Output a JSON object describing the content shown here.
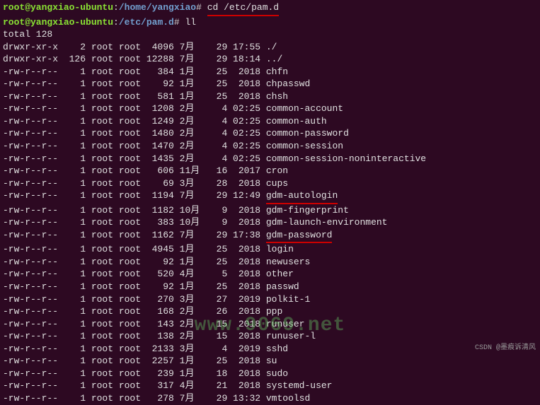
{
  "prompt1": {
    "userhost": "root@yangxiao-ubuntu",
    "path": "/home/yangxiao",
    "symbol": "#",
    "command": "cd /etc/pam.d"
  },
  "prompt2": {
    "userhost": "root@yangxiao-ubuntu",
    "path": "/etc/pam.d",
    "symbol": "#",
    "command": "ll"
  },
  "total_line": "total 128",
  "listing": [
    {
      "perm": "drwxr-xr-x",
      "links": "2",
      "owner": "root",
      "group": "root",
      "size": "4096",
      "month": "7月",
      "day": "29",
      "time": "17:55",
      "name": "./"
    },
    {
      "perm": "drwxr-xr-x",
      "links": "126",
      "owner": "root",
      "group": "root",
      "size": "12288",
      "month": "7月",
      "day": "29",
      "time": "18:14",
      "name": "../"
    },
    {
      "perm": "-rw-r--r--",
      "links": "1",
      "owner": "root",
      "group": "root",
      "size": "384",
      "month": "1月",
      "day": "25",
      "time": "2018",
      "name": "chfn"
    },
    {
      "perm": "-rw-r--r--",
      "links": "1",
      "owner": "root",
      "group": "root",
      "size": "92",
      "month": "1月",
      "day": "25",
      "time": "2018",
      "name": "chpasswd"
    },
    {
      "perm": "-rw-r--r--",
      "links": "1",
      "owner": "root",
      "group": "root",
      "size": "581",
      "month": "1月",
      "day": "25",
      "time": "2018",
      "name": "chsh"
    },
    {
      "perm": "-rw-r--r--",
      "links": "1",
      "owner": "root",
      "group": "root",
      "size": "1208",
      "month": "2月",
      "day": "4",
      "time": "02:25",
      "name": "common-account"
    },
    {
      "perm": "-rw-r--r--",
      "links": "1",
      "owner": "root",
      "group": "root",
      "size": "1249",
      "month": "2月",
      "day": "4",
      "time": "02:25",
      "name": "common-auth"
    },
    {
      "perm": "-rw-r--r--",
      "links": "1",
      "owner": "root",
      "group": "root",
      "size": "1480",
      "month": "2月",
      "day": "4",
      "time": "02:25",
      "name": "common-password"
    },
    {
      "perm": "-rw-r--r--",
      "links": "1",
      "owner": "root",
      "group": "root",
      "size": "1470",
      "month": "2月",
      "day": "4",
      "time": "02:25",
      "name": "common-session"
    },
    {
      "perm": "-rw-r--r--",
      "links": "1",
      "owner": "root",
      "group": "root",
      "size": "1435",
      "month": "2月",
      "day": "4",
      "time": "02:25",
      "name": "common-session-noninteractive"
    },
    {
      "perm": "-rw-r--r--",
      "links": "1",
      "owner": "root",
      "group": "root",
      "size": "606",
      "month": "11月",
      "day": "16",
      "time": "2017",
      "name": "cron"
    },
    {
      "perm": "-rw-r--r--",
      "links": "1",
      "owner": "root",
      "group": "root",
      "size": "69",
      "month": "3月",
      "day": "28",
      "time": "2018",
      "name": "cups"
    },
    {
      "perm": "-rw-r--r--",
      "links": "1",
      "owner": "root",
      "group": "root",
      "size": "1194",
      "month": "7月",
      "day": "29",
      "time": "12:49",
      "name": "gdm-autologin",
      "underline": true
    },
    {
      "perm": "-rw-r--r--",
      "links": "1",
      "owner": "root",
      "group": "root",
      "size": "1182",
      "month": "10月",
      "day": "9",
      "time": "2018",
      "name": "gdm-fingerprint"
    },
    {
      "perm": "-rw-r--r--",
      "links": "1",
      "owner": "root",
      "group": "root",
      "size": "383",
      "month": "10月",
      "day": "9",
      "time": "2018",
      "name": "gdm-launch-environment"
    },
    {
      "perm": "-rw-r--r--",
      "links": "1",
      "owner": "root",
      "group": "root",
      "size": "1162",
      "month": "7月",
      "day": "29",
      "time": "17:38",
      "name": "gdm-password",
      "underline": true
    },
    {
      "perm": "-rw-r--r--",
      "links": "1",
      "owner": "root",
      "group": "root",
      "size": "4945",
      "month": "1月",
      "day": "25",
      "time": "2018",
      "name": "login"
    },
    {
      "perm": "-rw-r--r--",
      "links": "1",
      "owner": "root",
      "group": "root",
      "size": "92",
      "month": "1月",
      "day": "25",
      "time": "2018",
      "name": "newusers"
    },
    {
      "perm": "-rw-r--r--",
      "links": "1",
      "owner": "root",
      "group": "root",
      "size": "520",
      "month": "4月",
      "day": "5",
      "time": "2018",
      "name": "other"
    },
    {
      "perm": "-rw-r--r--",
      "links": "1",
      "owner": "root",
      "group": "root",
      "size": "92",
      "month": "1月",
      "day": "25",
      "time": "2018",
      "name": "passwd"
    },
    {
      "perm": "-rw-r--r--",
      "links": "1",
      "owner": "root",
      "group": "root",
      "size": "270",
      "month": "3月",
      "day": "27",
      "time": "2019",
      "name": "polkit-1"
    },
    {
      "perm": "-rw-r--r--",
      "links": "1",
      "owner": "root",
      "group": "root",
      "size": "168",
      "month": "2月",
      "day": "26",
      "time": "2018",
      "name": "ppp"
    },
    {
      "perm": "-rw-r--r--",
      "links": "1",
      "owner": "root",
      "group": "root",
      "size": "143",
      "month": "2月",
      "day": "15",
      "time": "2018",
      "name": "runuser"
    },
    {
      "perm": "-rw-r--r--",
      "links": "1",
      "owner": "root",
      "group": "root",
      "size": "138",
      "month": "2月",
      "day": "15",
      "time": "2018",
      "name": "runuser-l"
    },
    {
      "perm": "-rw-r--r--",
      "links": "1",
      "owner": "root",
      "group": "root",
      "size": "2133",
      "month": "3月",
      "day": "4",
      "time": "2019",
      "name": "sshd"
    },
    {
      "perm": "-rw-r--r--",
      "links": "1",
      "owner": "root",
      "group": "root",
      "size": "2257",
      "month": "1月",
      "day": "25",
      "time": "2018",
      "name": "su"
    },
    {
      "perm": "-rw-r--r--",
      "links": "1",
      "owner": "root",
      "group": "root",
      "size": "239",
      "month": "1月",
      "day": "18",
      "time": "2018",
      "name": "sudo"
    },
    {
      "perm": "-rw-r--r--",
      "links": "1",
      "owner": "root",
      "group": "root",
      "size": "317",
      "month": "4月",
      "day": "21",
      "time": "2018",
      "name": "systemd-user"
    },
    {
      "perm": "-rw-r--r--",
      "links": "1",
      "owner": "root",
      "group": "root",
      "size": "278",
      "month": "7月",
      "day": "29",
      "time": "13:32",
      "name": "vmtoolsd"
    }
  ],
  "watermark": "www.9069.net",
  "footer": "CSDN @墨痕诉清风"
}
